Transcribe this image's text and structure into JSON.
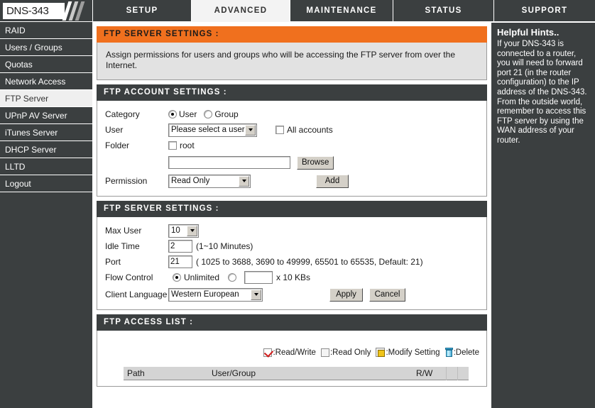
{
  "brand": {
    "logo_text": "DNS-343"
  },
  "tabs": [
    {
      "label": "SETUP",
      "active": false
    },
    {
      "label": "ADVANCED",
      "active": true
    },
    {
      "label": "MAINTENANCE",
      "active": false
    },
    {
      "label": "STATUS",
      "active": false
    },
    {
      "label": "SUPPORT",
      "active": false
    }
  ],
  "sidebar": {
    "items": [
      {
        "label": "RAID",
        "active": false
      },
      {
        "label": "Users / Groups",
        "active": false
      },
      {
        "label": "Quotas",
        "active": false
      },
      {
        "label": "Network Access",
        "active": false
      },
      {
        "label": "FTP Server",
        "active": true
      },
      {
        "label": "UPnP AV Server",
        "active": false
      },
      {
        "label": "iTunes Server",
        "active": false
      },
      {
        "label": "DHCP Server",
        "active": false
      },
      {
        "label": "LLTD",
        "active": false
      },
      {
        "label": "Logout",
        "active": false
      }
    ]
  },
  "intro_panel": {
    "title": "FTP SERVER SETTINGS :",
    "text": "Assign permissions for users and groups who will be accessing the FTP server from over the Internet."
  },
  "account_panel": {
    "title": "FTP ACCOUNT SETTINGS :",
    "category_label": "Category",
    "category_user_label": "User",
    "category_group_label": "Group",
    "category_selected": "User",
    "user_label": "User",
    "user_select_value": "Please select a user",
    "all_accounts_label": "All accounts",
    "all_accounts_checked": false,
    "folder_label": "Folder",
    "root_label": "root",
    "root_checked": false,
    "folder_path_value": "",
    "browse_label": "Browse",
    "permission_label": "Permission",
    "permission_value": "Read Only",
    "add_label": "Add"
  },
  "server_panel": {
    "title": "FTP SERVER SETTINGS :",
    "max_user_label": "Max User",
    "max_user_value": "10",
    "idle_time_label": "Idle Time",
    "idle_time_value": "2",
    "idle_time_hint": "(1~10 Minutes)",
    "port_label": "Port",
    "port_value": "21",
    "port_hint": "( 1025 to 3688, 3690 to 49999, 65501 to 65535, Default: 21)",
    "flow_control_label": "Flow Control",
    "flow_unlimited_label": "Unlimited",
    "flow_selected": "Unlimited",
    "flow_rate_value": "",
    "flow_rate_unit": "x 10 KBs",
    "client_language_label": "Client Language",
    "client_language_value": "Western European",
    "apply_label": "Apply",
    "cancel_label": "Cancel"
  },
  "access_list_panel": {
    "title": "FTP ACCESS LIST :",
    "legend": [
      {
        "icon": "read-write-icon",
        "label": ":Read/Write"
      },
      {
        "icon": "read-only-icon",
        "label": ":Read Only"
      },
      {
        "icon": "modify-setting-icon",
        "label": ":Modify Setting"
      },
      {
        "icon": "delete-icon",
        "label": ":Delete"
      }
    ],
    "columns": [
      "Path",
      "User/Group",
      "R/W",
      "",
      ""
    ],
    "rows": []
  },
  "hints": {
    "title": "Helpful Hints..",
    "body": "If your DNS-343 is connected to a router, you will need to forward port 21 (in the router configuration) to the IP address of the DNS-343. From the outside world, remember to access this FTP server by using the WAN address of your router."
  },
  "colors": {
    "accent_orange": "#f0701e",
    "panel_dark": "#3b3f40",
    "checkmark_red": "#d11b1b",
    "trash_blue": "#3ea9d6"
  }
}
